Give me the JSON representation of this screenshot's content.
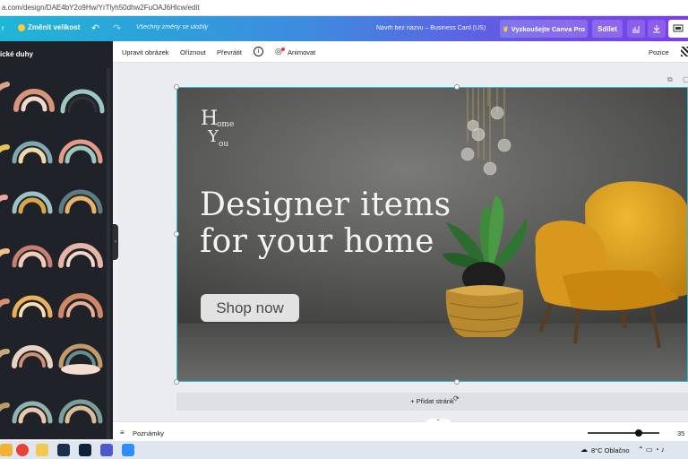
{
  "browser": {
    "url": "a.com/design/DAE4bY2o9Hw/YrTlyh50dhw2FuOAJ6Hlcw/edit"
  },
  "topbar": {
    "resize_label": "Změnit velikost",
    "saved_status": "Všechny změny se uložily",
    "doc_title": "Návrh bez názvu – Business Card (US)",
    "try_pro_label": "Vyzkoušejte Canva Pro",
    "share_label": "Sdílet",
    "back_label": "r"
  },
  "sidebar": {
    "title": "ické duhy"
  },
  "toolbar": {
    "edit_image": "Upravit obrázek",
    "crop": "Oříznout",
    "flip": "Převrátit",
    "info": "i",
    "animate": "Animovat",
    "position": "Pozice"
  },
  "design": {
    "logo_h": "H",
    "logo_ome": "ome",
    "logo_y": "Y",
    "logo_ou": "ou",
    "headline_line1": "Designer items",
    "headline_line2": "for your home",
    "cta": "Shop now"
  },
  "canvas": {
    "add_page": "+ Přidat stránk"
  },
  "bottombar": {
    "notes": "Poznámky",
    "zoom": "35"
  },
  "taskbar": {
    "weather": "8°C  Oblačno"
  },
  "colors": {
    "accent": "#27c2d4",
    "chair": "#d99a1a",
    "brand_gradient_start": "#1fb6d6",
    "brand_gradient_end": "#7a3fe8"
  }
}
